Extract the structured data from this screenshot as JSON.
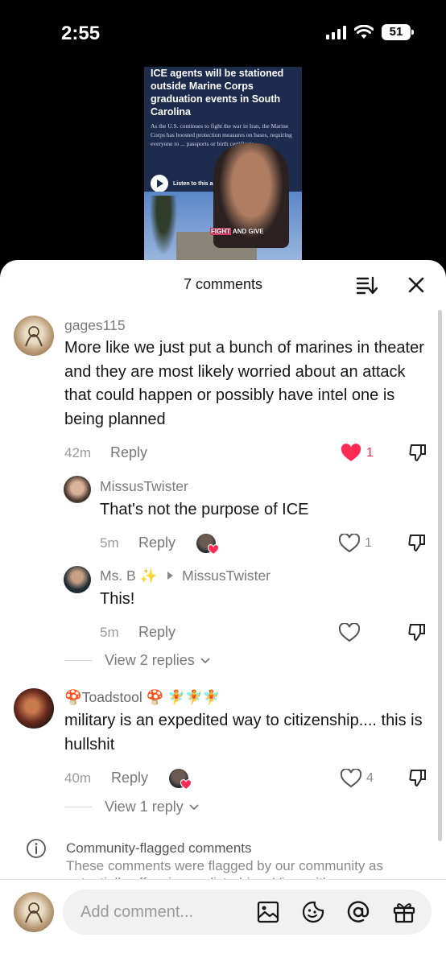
{
  "status_bar": {
    "time": "2:55",
    "battery": "51"
  },
  "video": {
    "headline": "ICE agents will be stationed outside Marine Corps graduation events in South Carolina",
    "body": "As the U.S. continues to fight the war in Iran, the Marine Corps has boosted protection measures on bases, requiring everyone to ... passports or birth certificate...",
    "listen_label": "Listen to this artic...",
    "caption_highlight": "FIGHT",
    "caption_rest": " AND GIVE"
  },
  "sheet": {
    "title": "7 comments"
  },
  "comments": [
    {
      "username": "gages115",
      "text": "More like we just put a bunch of marines in theater and they are most likely worried about an attack that could happen or possibly have intel one is being planned",
      "time": "42m",
      "reply_label": "Reply",
      "likes": "1",
      "liked": true
    },
    {
      "username": "MissusTwister",
      "text": "That's not the purpose of ICE",
      "time": "5m",
      "reply_label": "Reply",
      "likes": "1"
    },
    {
      "username": "Ms. B ✨",
      "reply_to": "MissusTwister",
      "text": "This!",
      "time": "5m",
      "reply_label": "Reply",
      "likes": ""
    },
    {
      "username": "🍄Toadstool 🍄 🧚🧚🧚",
      "text": "military is an expedited way to citizenship.... this is hullshit",
      "time": "40m",
      "reply_label": "Reply",
      "likes": "4"
    }
  ],
  "view_replies": [
    "View 2 replies",
    "View 1 reply"
  ],
  "flagged": {
    "title": "Community-flagged comments",
    "subtitle": "These comments were flagged by our community as potentially offensive or disturbing. View with..."
  },
  "composer": {
    "placeholder": "Add comment..."
  },
  "colors": {
    "like_red": "#fe2c55",
    "text": "#161616",
    "muted": "#7a7a7a"
  }
}
